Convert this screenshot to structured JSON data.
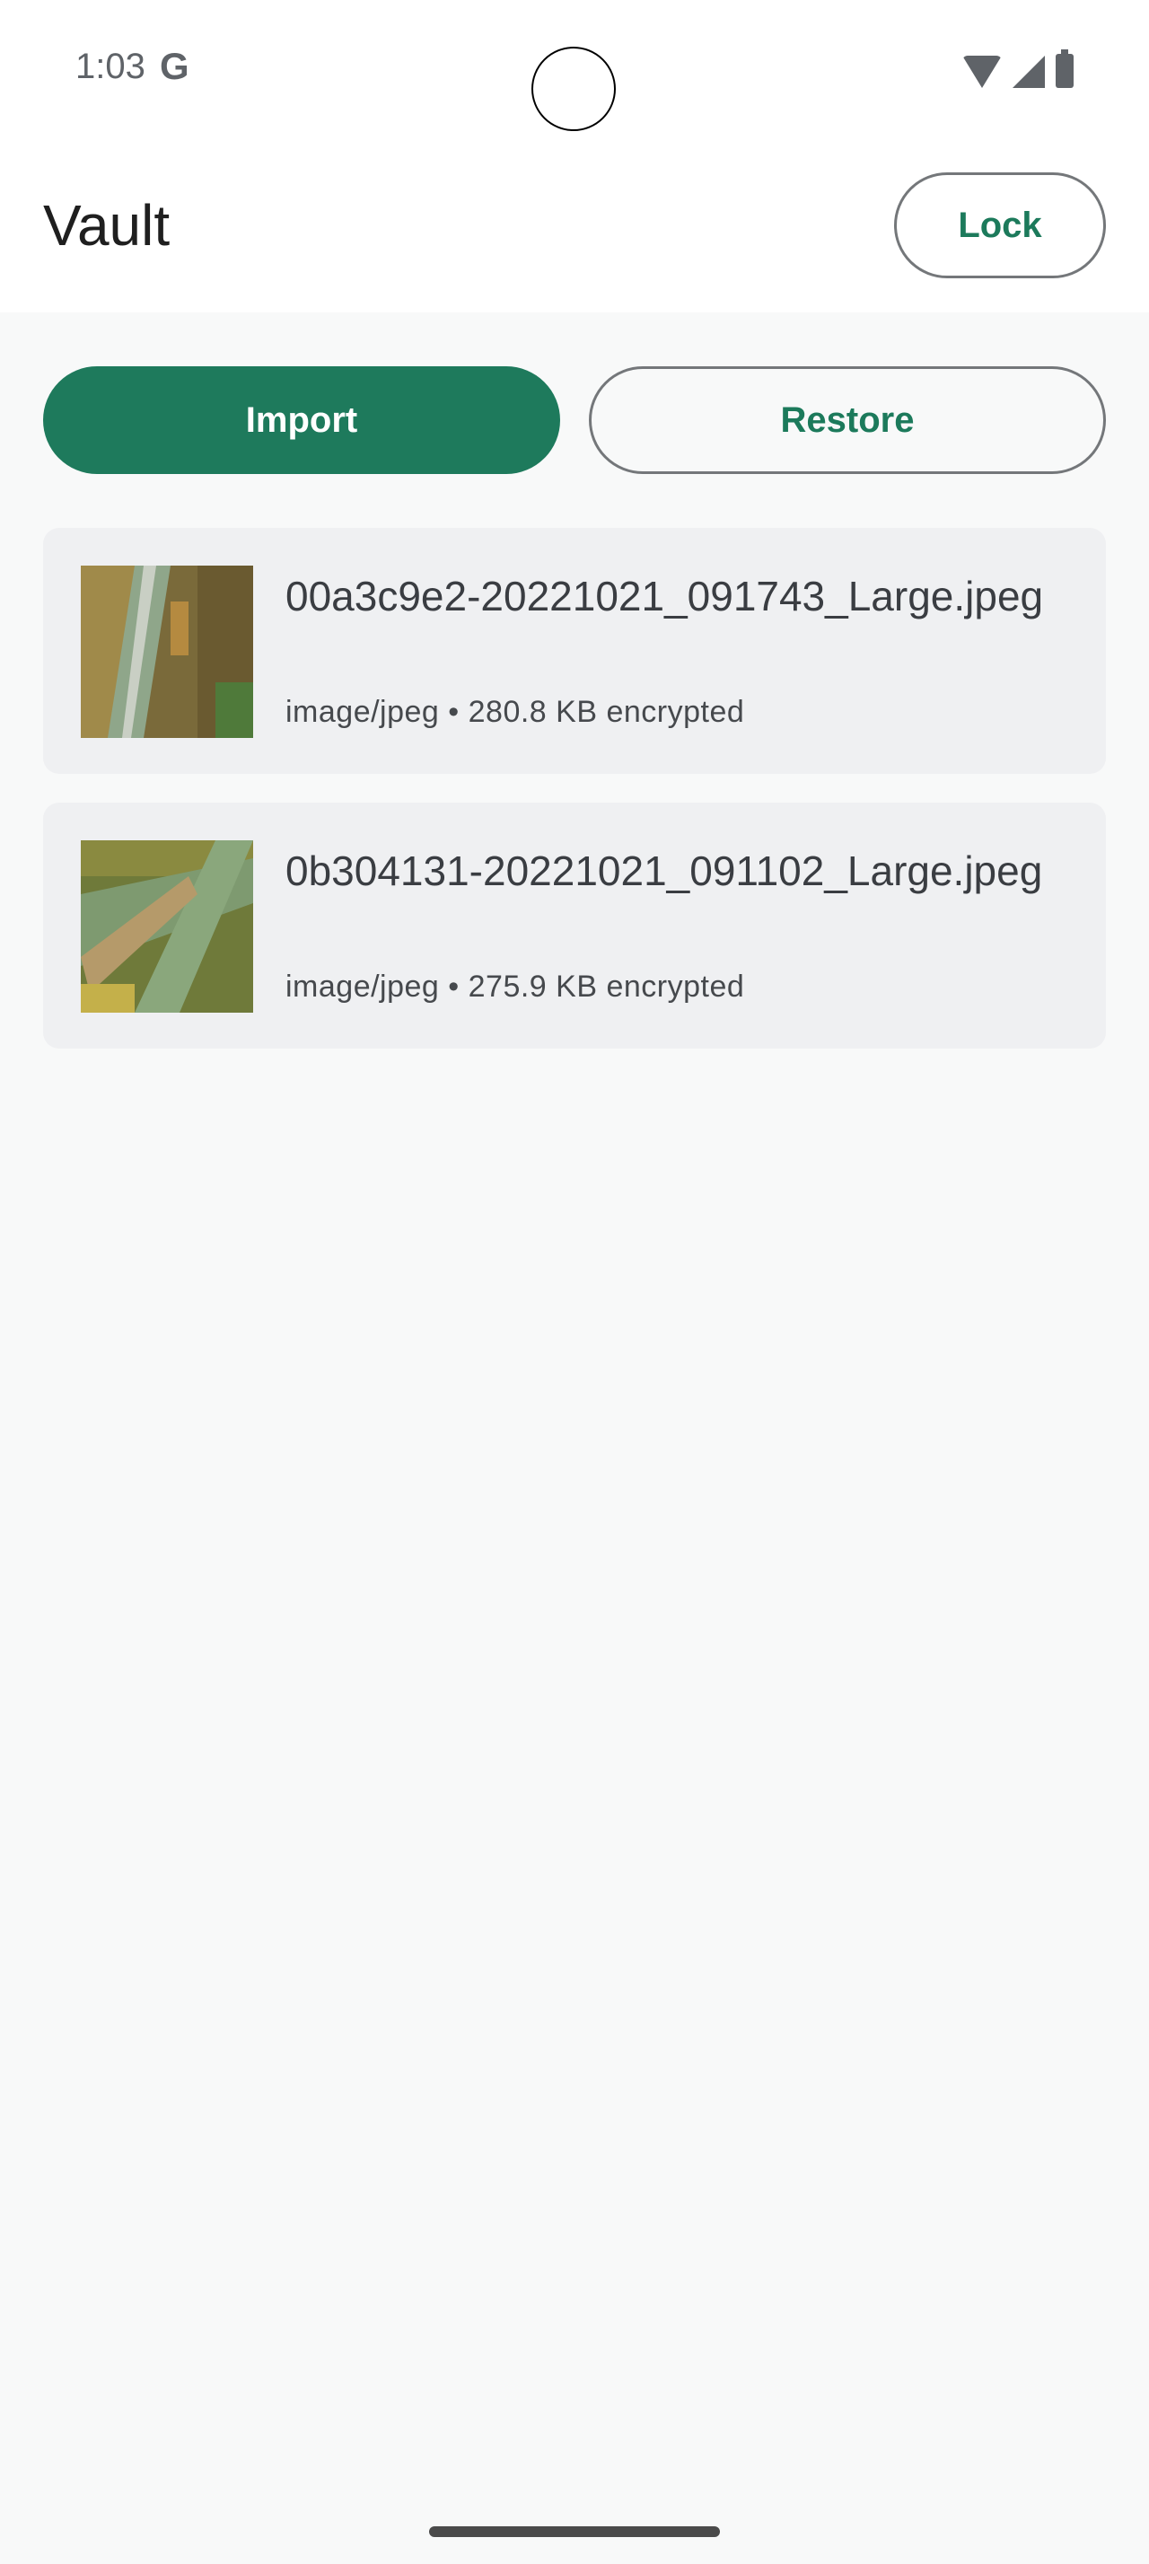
{
  "status_bar": {
    "time": "1:03",
    "g_letter": "G"
  },
  "app_bar": {
    "title": "Vault",
    "lock_label": "Lock"
  },
  "actions": {
    "import_label": "Import",
    "restore_label": "Restore"
  },
  "files": [
    {
      "name": "00a3c9e2-20221021_091743_Large.jpeg",
      "meta": "image/jpeg • 280.8 KB encrypted"
    },
    {
      "name": "0b304131-20221021_091102_Large.jpeg",
      "meta": "image/jpeg • 275.9 KB encrypted"
    }
  ],
  "colors": {
    "accent": "#1e7a5c",
    "surface": "#f8f9f9",
    "card": "#eff0f2"
  }
}
